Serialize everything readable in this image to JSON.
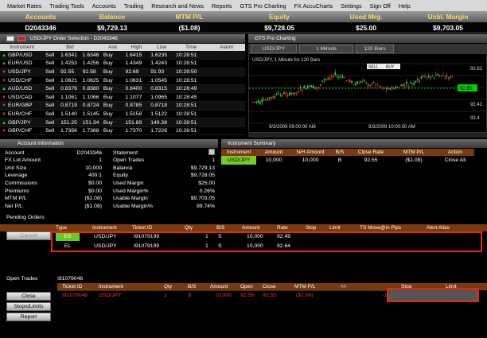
{
  "menu": [
    "Market Rates",
    "Trading Tools",
    "Accounts",
    "Trading",
    "Research and News",
    "Reports",
    "GTS Pro Charting",
    "FX AccuCharts",
    "Settings",
    "Sign Off",
    "Help"
  ],
  "summary": {
    "headers": [
      "Accounts",
      "Balance",
      "MTM P/L",
      "Equity",
      "Used Mrg.",
      "Usbl. Margin"
    ],
    "values": [
      "D2043346",
      "$9,729.13",
      "($1.08)",
      "$9,728.05",
      "$25.00",
      "$9,703.05"
    ]
  },
  "rates": {
    "title": "USD/JPY Order Selection - D2043346",
    "columns": [
      "Instrument",
      "",
      "Bid",
      "",
      "Ask",
      "High",
      "Low",
      "Time",
      "Alarm"
    ],
    "rows": [
      [
        "up",
        "GBP/USD",
        "Sell",
        "1.6341",
        "1.6346",
        "Buy",
        "1.6415",
        "1.6235",
        "10:28:51"
      ],
      [
        "up",
        "EUR/USD",
        "Sell",
        "1.4253",
        "1.4256",
        "Buy",
        "1.4349",
        "1.4243",
        "10:28:51"
      ],
      [
        "dn",
        "USD/JPY",
        "Sell",
        "92.55",
        "92.58",
        "Buy",
        "92.69",
        "91.93",
        "10:28:50"
      ],
      [
        "dn",
        "USD/CHF",
        "Sell",
        "1.0621",
        "1.0625",
        "Buy",
        "1.0631",
        "1.0545",
        "10:28:51"
      ],
      [
        "up",
        "AUD/USD",
        "Sell",
        "0.8376",
        "0.8380",
        "Buy",
        "0.8400",
        "0.8315",
        "10:28:49"
      ],
      [
        "dn",
        "USD/CAD",
        "Sell",
        "1.1061",
        "1.1066",
        "Buy",
        "1.1077",
        "1.0965",
        "10:28:45"
      ],
      [
        "dn",
        "EUR/GBP",
        "Sell",
        "0.8719",
        "0.8724",
        "Buy",
        "0.8785",
        "0.8718",
        "10:28:51"
      ],
      [
        "dn",
        "EUR/CHF",
        "Sell",
        "1.5140",
        "1.5145",
        "Buy",
        "1.5158",
        "1.5122",
        "10:28:51"
      ],
      [
        "up",
        "GBP/JPY",
        "Sell",
        "151.25",
        "151.34",
        "Buy",
        "151.89",
        "149.38",
        "10:28:51"
      ],
      [
        "dn",
        "GBP/CHF",
        "Sell",
        "1.7356",
        "1.7368",
        "Buy",
        "1.7370",
        "1.7228",
        "10:28:51"
      ]
    ]
  },
  "chart": {
    "title": "GTS Pro Charting",
    "symbol": "USD/JPY",
    "interval": "1 Minute",
    "bars": "120 Bars",
    "legend": "USD/JPY, 1 Minute for 120 Bars",
    "sell": "SELL",
    "buy": "BUY",
    "price": "92.55",
    "yticks": [
      "92.61",
      "92.42",
      "92.4"
    ],
    "xticks": [
      "9/3/2009 09:00:00 AM",
      "9/3/2009 10:00:00 AM"
    ]
  },
  "chart_data": {
    "type": "candlestick",
    "x": [
      "9/3/2009 09:00:00 AM",
      "9/3/2009 10:00:00 AM"
    ],
    "current_price": 92.55,
    "yticks": [
      92.61,
      92.42,
      92.4
    ]
  },
  "account": {
    "title": "Account Information",
    "left": [
      [
        "Account",
        "D2043346"
      ],
      [
        "FX Lot Amount",
        "1"
      ],
      [
        "Unit Size",
        "10,000"
      ],
      [
        "Leverage",
        "400:1"
      ],
      [
        "Commissions",
        "$0.00"
      ],
      [
        "Premiums",
        "$0.00"
      ],
      [
        "MTM P/L",
        "($1.08)"
      ],
      [
        "Net P/L",
        "($1.08)"
      ]
    ],
    "right": [
      [
        "Statement",
        ""
      ],
      [
        "Open Trades",
        "1"
      ],
      [
        "Balance",
        "$9,729.13"
      ],
      [
        "Equity",
        "$9,728.05"
      ],
      [
        "Used Margin",
        "$25.00"
      ],
      [
        "Used Margin%",
        "0.26%"
      ],
      [
        "Usable Margin",
        "$9,703.05"
      ],
      [
        "Usable Margin%",
        "99.74%"
      ]
    ]
  },
  "instr": {
    "title": "Instrument Summary",
    "columns": [
      "Instrument",
      "Amount",
      "N/H Amount",
      "B/S",
      "Close Rate",
      "MTM P/L",
      "Action"
    ],
    "row": [
      "USD/JPY",
      "10,000",
      "10,000",
      "B",
      "92.55",
      "($1.08)",
      "Close All"
    ]
  },
  "pending": {
    "title": "Pending Orders",
    "cancel": "Cancel",
    "columns": [
      "Type",
      "Instrument",
      "Ticket ID",
      "Qty",
      "B/S",
      "Amount",
      "Rate",
      "Stop",
      "Limit",
      "TS Move@in Pips",
      "Alert Alias"
    ],
    "rows": [
      [
        "ES",
        "USD/JPY",
        "I91079199",
        "1",
        "S",
        "10,000",
        "92.49"
      ],
      [
        "EL",
        "USD/JPY",
        "I91079199",
        "1",
        "S",
        "10,000",
        "92.64"
      ]
    ]
  },
  "open": {
    "title": "Open Trades",
    "ticket": "I91079046",
    "columns": [
      "Ticket ID",
      "Instrument",
      "Qty",
      "B/S",
      "Amount",
      "Open",
      "Close",
      "MTM P/L",
      "+/-",
      "Stop",
      "Limit"
    ],
    "row": [
      "I91079046",
      "USD/JPY",
      "1",
      "B",
      "10,000",
      "92.56",
      "92.55",
      "($1.08)",
      "-1"
    ],
    "buttons": [
      "Close",
      "Stops/Limits",
      "Report"
    ]
  }
}
